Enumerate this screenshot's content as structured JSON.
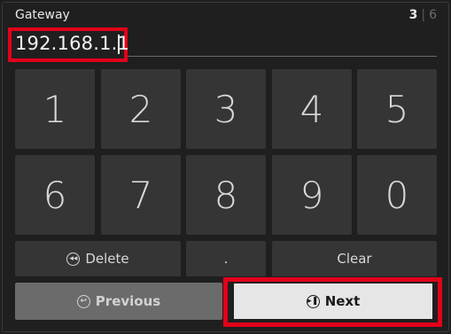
{
  "title": "Gateway",
  "step": {
    "current": "3",
    "separator": "|",
    "total": "6"
  },
  "input": {
    "value": "192.168.1.1"
  },
  "keypad": {
    "digits": [
      "1",
      "2",
      "3",
      "4",
      "5",
      "6",
      "7",
      "8",
      "9",
      "0"
    ],
    "delete_label": "Delete",
    "dot_label": ".",
    "clear_label": "Clear"
  },
  "nav": {
    "previous_label": "Previous",
    "next_label": "Next"
  },
  "icons": {
    "delete": "rewind-circle-icon",
    "previous": "back-circle-icon",
    "next": "play-pause-circle-icon"
  },
  "colors": {
    "background": "#1f1f1f",
    "key": "#353535",
    "highlight": "#e2001a",
    "previous_button": "#6b6b6b",
    "next_button": "#e6e6e6"
  }
}
